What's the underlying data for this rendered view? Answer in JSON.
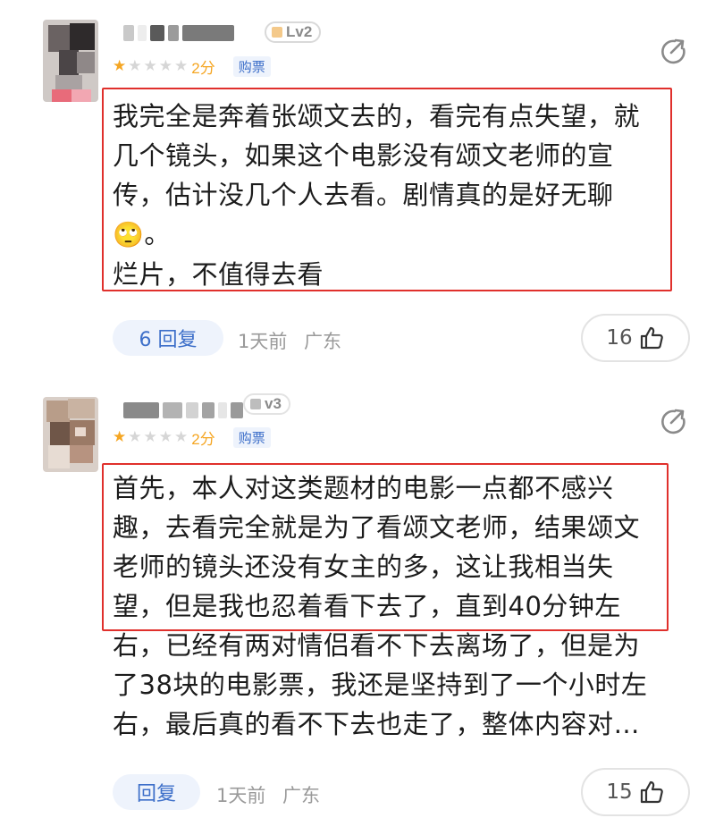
{
  "comments": [
    {
      "level": "Lv2",
      "rating": {
        "stars_filled": 1,
        "stars_total": 5,
        "score": "2分",
        "tag": "购票"
      },
      "body_lines": [
        "我完全是奔着张颂文去的，看完有点失望，就",
        "几个镜头，如果这个电影没有颂文老师的宣",
        "传，估计没几个人去看。剧情真的是好无聊",
        "。",
        "烂片，不值得去看"
      ],
      "emoji": "🙄",
      "reply_label": "6 回复",
      "time": "1天前",
      "location": "广东",
      "likes": "16"
    },
    {
      "level": "v3",
      "rating": {
        "stars_filled": 1,
        "stars_total": 5,
        "score": "2分",
        "tag": "购票"
      },
      "body_lines": [
        "首先，本人对这类题材的电影一点都不感兴",
        "趣，去看完全就是为了看颂文老师，结果颂文",
        "老师的镜头还没有女主的多，这让我相当失",
        "望，但是我也忍着看下去了，直到40分钟左",
        "右，已经有两对情侣看不下去离场了，但是为",
        "了38块的电影票，我还是坚持到了一个小时左",
        "右，最后真的看不下去也走了，整体内容对…"
      ],
      "reply_label": "回复",
      "time": "1天前",
      "location": "广东",
      "likes": "15"
    }
  ],
  "colors": {
    "star": "#f5a623",
    "highlight_border": "#e0302c",
    "accent": "#3d6fc9"
  },
  "icons": {
    "share": "share-icon",
    "like": "thumbs-up-icon",
    "star": "star-icon"
  }
}
